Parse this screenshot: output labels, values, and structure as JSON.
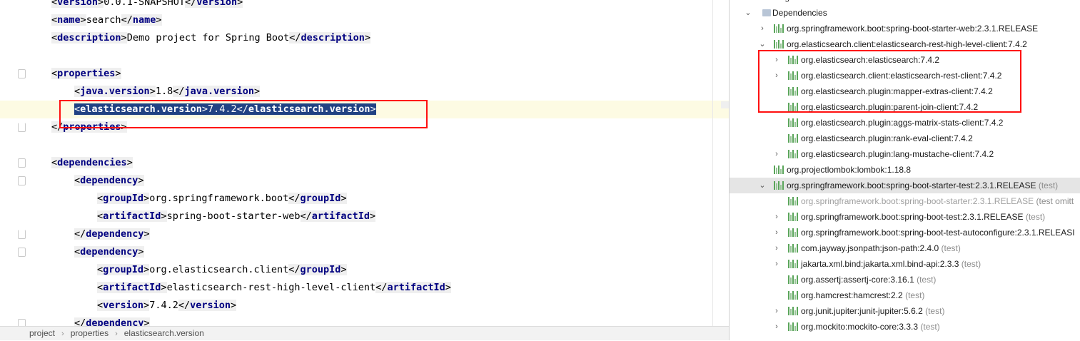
{
  "editor": {
    "lines": [
      {
        "indent": 0,
        "parts": [
          [
            "br",
            "<"
          ],
          [
            "tag",
            "version"
          ],
          [
            "br",
            ">"
          ],
          [
            "txt",
            "0.0.1-SNAPSHOT"
          ],
          [
            "br",
            "</"
          ],
          [
            "tag",
            "version"
          ],
          [
            "br",
            ">"
          ]
        ]
      },
      {
        "indent": 0,
        "parts": [
          [
            "br",
            "<"
          ],
          [
            "tag",
            "name"
          ],
          [
            "br",
            ">"
          ],
          [
            "txt",
            "search"
          ],
          [
            "br",
            "</"
          ],
          [
            "tag",
            "name"
          ],
          [
            "br",
            ">"
          ]
        ]
      },
      {
        "indent": 0,
        "parts": [
          [
            "br",
            "<"
          ],
          [
            "tag",
            "description"
          ],
          [
            "br",
            ">"
          ],
          [
            "txt",
            "Demo project for Spring Boot"
          ],
          [
            "br",
            "</"
          ],
          [
            "tag",
            "description"
          ],
          [
            "br",
            ">"
          ]
        ]
      },
      {
        "indent": 0,
        "parts": []
      },
      {
        "indent": 0,
        "parts": [
          [
            "br",
            "<"
          ],
          [
            "tag",
            "properties"
          ],
          [
            "br",
            ">"
          ]
        ]
      },
      {
        "indent": 1,
        "parts": [
          [
            "br",
            "<"
          ],
          [
            "tag",
            "java.version"
          ],
          [
            "br",
            ">"
          ],
          [
            "txt",
            "1.8"
          ],
          [
            "br",
            "</"
          ],
          [
            "tag",
            "java.version"
          ],
          [
            "br",
            ">"
          ]
        ]
      },
      {
        "indent": 1,
        "selected": true,
        "parts": [
          [
            "br",
            "<"
          ],
          [
            "tag",
            "elasticsearch.version"
          ],
          [
            "br",
            ">"
          ],
          [
            "txt",
            "7.4.2"
          ],
          [
            "br",
            "</"
          ],
          [
            "tag",
            "elasticsearch.version"
          ],
          [
            "br",
            ">"
          ]
        ]
      },
      {
        "indent": 0,
        "parts": [
          [
            "br",
            "</"
          ],
          [
            "tag",
            "properties"
          ],
          [
            "br",
            ">"
          ]
        ]
      },
      {
        "indent": 0,
        "parts": []
      },
      {
        "indent": 0,
        "parts": [
          [
            "br",
            "<"
          ],
          [
            "tag",
            "dependencies"
          ],
          [
            "br",
            ">"
          ]
        ]
      },
      {
        "indent": 1,
        "parts": [
          [
            "br",
            "<"
          ],
          [
            "tag",
            "dependency"
          ],
          [
            "br",
            ">"
          ]
        ]
      },
      {
        "indent": 2,
        "parts": [
          [
            "br",
            "<"
          ],
          [
            "tag",
            "groupId"
          ],
          [
            "br",
            ">"
          ],
          [
            "txt",
            "org.springframework.boot"
          ],
          [
            "br",
            "</"
          ],
          [
            "tag",
            "groupId"
          ],
          [
            "br",
            ">"
          ]
        ]
      },
      {
        "indent": 2,
        "parts": [
          [
            "br",
            "<"
          ],
          [
            "tag",
            "artifactId"
          ],
          [
            "br",
            ">"
          ],
          [
            "txt",
            "spring-boot-starter-web"
          ],
          [
            "br",
            "</"
          ],
          [
            "tag",
            "artifactId"
          ],
          [
            "br",
            ">"
          ]
        ]
      },
      {
        "indent": 1,
        "parts": [
          [
            "br",
            "</"
          ],
          [
            "tag",
            "dependency"
          ],
          [
            "br",
            ">"
          ]
        ]
      },
      {
        "indent": 1,
        "parts": [
          [
            "br",
            "<"
          ],
          [
            "tag",
            "dependency"
          ],
          [
            "br",
            ">"
          ]
        ]
      },
      {
        "indent": 2,
        "parts": [
          [
            "br",
            "<"
          ],
          [
            "tag",
            "groupId"
          ],
          [
            "br",
            ">"
          ],
          [
            "txt",
            "org.elasticsearch.client"
          ],
          [
            "br",
            "</"
          ],
          [
            "tag",
            "groupId"
          ],
          [
            "br",
            ">"
          ]
        ]
      },
      {
        "indent": 2,
        "parts": [
          [
            "br",
            "<"
          ],
          [
            "tag",
            "artifactId"
          ],
          [
            "br",
            ">"
          ],
          [
            "txt",
            "elasticsearch-rest-high-level-client"
          ],
          [
            "br",
            "</"
          ],
          [
            "tag",
            "artifactId"
          ],
          [
            "br",
            ">"
          ]
        ]
      },
      {
        "indent": 2,
        "parts": [
          [
            "br",
            "<"
          ],
          [
            "tag",
            "version"
          ],
          [
            "br",
            ">"
          ],
          [
            "txt",
            "7.4.2"
          ],
          [
            "br",
            "</"
          ],
          [
            "tag",
            "version"
          ],
          [
            "br",
            ">"
          ]
        ]
      },
      {
        "indent": 1,
        "parts": [
          [
            "br",
            "</"
          ],
          [
            "tag",
            "dependency"
          ],
          [
            "br",
            ">"
          ]
        ]
      }
    ],
    "gutter": {
      "folds": [
        4,
        7,
        9,
        10,
        13,
        14,
        18
      ],
      "fold_ends": [
        7,
        13
      ],
      "bulb_line": 6
    }
  },
  "breadcrumb": [
    "project",
    "properties",
    "elasticsearch.version"
  ],
  "breadcrumb_separator": "›",
  "maven_tree": [
    {
      "level": 1,
      "arrow": "",
      "icon": "none",
      "label": "Plugins",
      "scope": ""
    },
    {
      "level": 1,
      "arrow": "⌄",
      "icon": "folder-icon",
      "label": "Dependencies",
      "scope": ""
    },
    {
      "level": 2,
      "arrow": "›",
      "icon": "library-icon",
      "label": "org.springframework.boot:spring-boot-starter-web:2.3.1.RELEASE",
      "scope": ""
    },
    {
      "level": 2,
      "arrow": "⌄",
      "icon": "library-icon",
      "label": "org.elasticsearch.client:elasticsearch-rest-high-level-client:7.4.2",
      "scope": ""
    },
    {
      "level": 3,
      "arrow": "›",
      "icon": "library-icon",
      "label": "org.elasticsearch:elasticsearch:7.4.2",
      "scope": ""
    },
    {
      "level": 3,
      "arrow": "›",
      "icon": "library-icon",
      "label": "org.elasticsearch.client:elasticsearch-rest-client:7.4.2",
      "scope": ""
    },
    {
      "level": 3,
      "arrow": "",
      "icon": "library-icon",
      "label": "org.elasticsearch.plugin:mapper-extras-client:7.4.2",
      "scope": ""
    },
    {
      "level": 3,
      "arrow": "",
      "icon": "library-icon",
      "label": "org.elasticsearch.plugin:parent-join-client:7.4.2",
      "scope": ""
    },
    {
      "level": 3,
      "arrow": "",
      "icon": "library-icon",
      "label": "org.elasticsearch.plugin:aggs-matrix-stats-client:7.4.2",
      "scope": ""
    },
    {
      "level": 3,
      "arrow": "",
      "icon": "library-icon",
      "label": "org.elasticsearch.plugin:rank-eval-client:7.4.2",
      "scope": ""
    },
    {
      "level": 3,
      "arrow": "›",
      "icon": "library-icon",
      "label": "org.elasticsearch.plugin:lang-mustache-client:7.4.2",
      "scope": ""
    },
    {
      "level": 2,
      "arrow": "",
      "icon": "library-icon",
      "label": "org.projectlombok:lombok:1.18.8",
      "scope": ""
    },
    {
      "level": 2,
      "arrow": "⌄",
      "icon": "library-icon",
      "label": "org.springframework.boot:spring-boot-starter-test:2.3.1.RELEASE",
      "scope": " (test)",
      "selected": true
    },
    {
      "level": 3,
      "arrow": "",
      "icon": "library-icon",
      "label": "org.springframework.boot:spring-boot-starter:2.3.1.RELEASE",
      "scope": " (test omitt",
      "muted": true
    },
    {
      "level": 3,
      "arrow": "›",
      "icon": "library-icon",
      "label": "org.springframework.boot:spring-boot-test:2.3.1.RELEASE",
      "scope": " (test)"
    },
    {
      "level": 3,
      "arrow": "›",
      "icon": "library-icon",
      "label": "org.springframework.boot:spring-boot-test-autoconfigure:2.3.1.RELEASI",
      "scope": ""
    },
    {
      "level": 3,
      "arrow": "›",
      "icon": "library-icon",
      "label": "com.jayway.jsonpath:json-path:2.4.0",
      "scope": " (test)"
    },
    {
      "level": 3,
      "arrow": "›",
      "icon": "library-icon",
      "label": "jakarta.xml.bind:jakarta.xml.bind-api:2.3.3",
      "scope": " (test)"
    },
    {
      "level": 3,
      "arrow": "",
      "icon": "library-icon",
      "label": "org.assertj:assertj-core:3.16.1",
      "scope": " (test)"
    },
    {
      "level": 3,
      "arrow": "",
      "icon": "library-icon",
      "label": "org.hamcrest:hamcrest:2.2",
      "scope": " (test)"
    },
    {
      "level": 3,
      "arrow": "›",
      "icon": "library-icon",
      "label": "org.junit.jupiter:junit-jupiter:5.6.2",
      "scope": " (test)"
    },
    {
      "level": 3,
      "arrow": "›",
      "icon": "library-icon",
      "label": "org.mockito:mockito-core:3.3.3",
      "scope": " (test)"
    }
  ],
  "colors": {
    "highlight_box": "#ff1010",
    "selection": "#214283",
    "caret_line": "#fdfbe3",
    "tag": "#000080"
  }
}
